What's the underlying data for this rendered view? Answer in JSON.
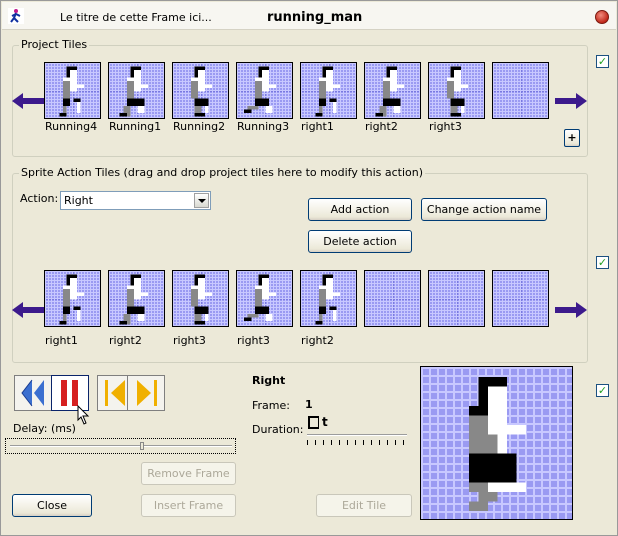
{
  "window": {
    "subtitle": "Le titre de cette Frame ici...",
    "title": "running_man"
  },
  "project_tiles": {
    "group_label": "Project Tiles",
    "tiles": [
      {
        "label": "Running4"
      },
      {
        "label": "Running1"
      },
      {
        "label": "Running2"
      },
      {
        "label": "Running3"
      },
      {
        "label": "right1"
      },
      {
        "label": "right2"
      },
      {
        "label": "right3"
      },
      {
        "label": ""
      }
    ],
    "add_label": "+"
  },
  "action_tiles": {
    "group_label": "Sprite Action Tiles (drag and drop project tiles here to modify this action)",
    "action_label": "Action:",
    "action_value": "Right",
    "add_action": "Add action",
    "change_action_name": "Change action name",
    "delete_action": "Delete action",
    "tiles": [
      {
        "label": "right1"
      },
      {
        "label": "right2"
      },
      {
        "label": "right3"
      },
      {
        "label": "right3"
      },
      {
        "label": "right2"
      },
      {
        "label": ""
      },
      {
        "label": ""
      },
      {
        "label": ""
      }
    ]
  },
  "playback": {
    "delay_label": "Delay: (ms)",
    "remove_frame": "Remove Frame",
    "insert_frame": "Insert Frame",
    "close": "Close",
    "edit_tile": "Edit Tile"
  },
  "info": {
    "action_name": "Right",
    "frame_label": "Frame:",
    "frame_value": "1",
    "duration_label": "Duration:",
    "duration_value": "t"
  },
  "checkboxes": {
    "check": "✓"
  },
  "colors": {
    "tile_bg": "#9a9af2",
    "arrow": "#3c1a8c",
    "play_blue": "#3b6fd0",
    "pause_red": "#d62020",
    "step_yellow": "#f0b000"
  }
}
